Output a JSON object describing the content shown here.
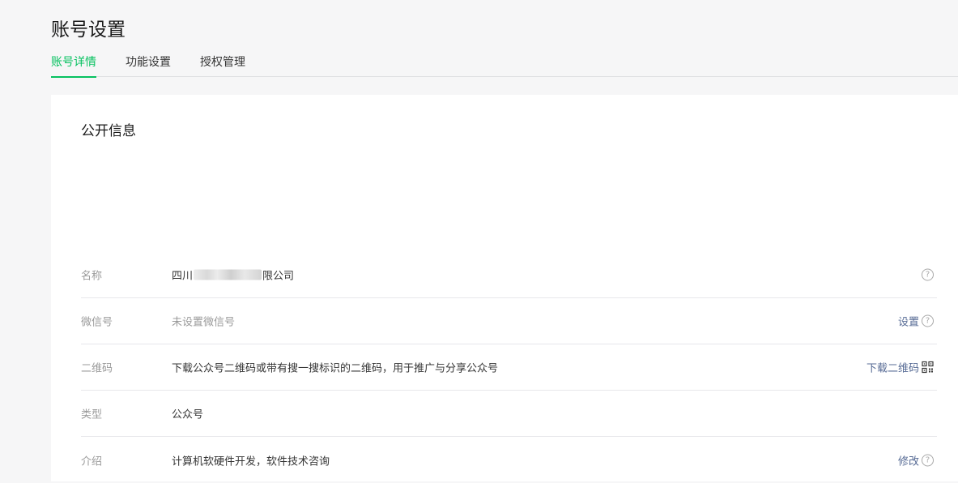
{
  "header": {
    "title": "账号设置",
    "tabs": [
      {
        "label": "账号详情",
        "active": true
      },
      {
        "label": "功能设置",
        "active": false
      },
      {
        "label": "授权管理",
        "active": false
      }
    ]
  },
  "public_info": {
    "title": "公开信息",
    "rows": {
      "name": {
        "label": "名称",
        "value_prefix": "四川",
        "value_suffix": "限公司"
      },
      "wechat_id": {
        "label": "微信号",
        "value": "未设置微信号",
        "action": "设置"
      },
      "qrcode": {
        "label": "二维码",
        "value": "下载公众号二维码或带有搜一搜标识的二维码，用于推广与分享公众号",
        "action": "下载二维码"
      },
      "type": {
        "label": "类型",
        "value": "公众号"
      },
      "intro": {
        "label": "介绍",
        "value": "计算机软硬件开发，软件技术咨询",
        "action": "修改"
      }
    }
  },
  "icons": {
    "help": "help-circle-icon",
    "qr": "qr-code-icon"
  },
  "colors": {
    "accent": "#07c160",
    "link": "#576b95",
    "label": "#9a9a9a"
  }
}
